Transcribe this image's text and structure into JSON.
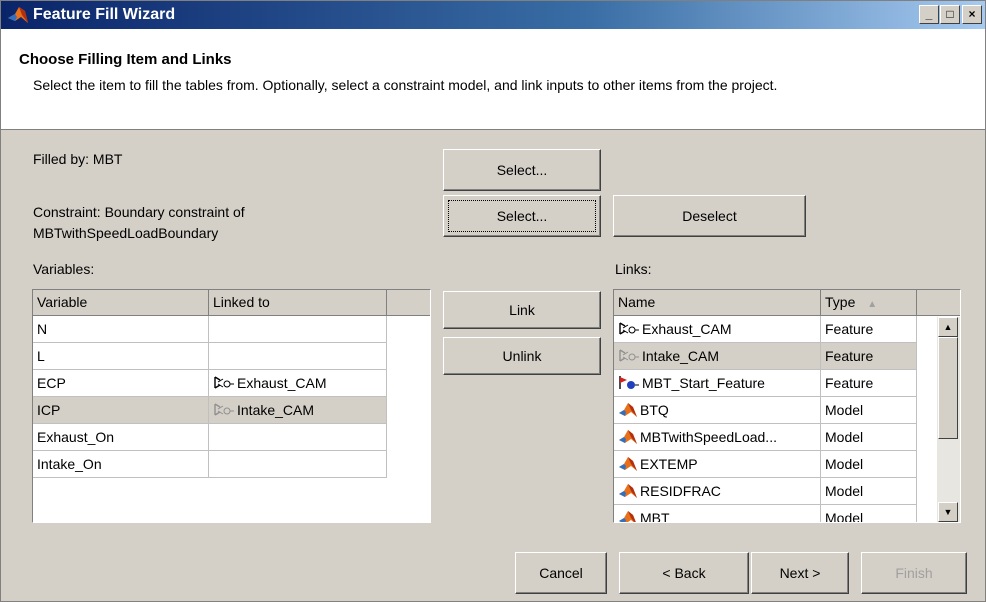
{
  "window": {
    "title": "Feature Fill Wizard",
    "controls": [
      "_",
      "□",
      "×"
    ]
  },
  "header": {
    "title": "Choose Filling Item and Links",
    "description": "Select the item to fill the tables from. Optionally, select a constraint model, and link inputs to other items from the project."
  },
  "filled_by": "Filled by: MBT",
  "constraint": {
    "line1": "Constraint: Boundary constraint of",
    "line2": "MBTwithSpeedLoadBoundary"
  },
  "buttons": {
    "select1": "Select...",
    "select2": "Select...",
    "deselect": "Deselect",
    "link": "Link",
    "unlink": "Unlink",
    "cancel": "Cancel",
    "back": "< Back",
    "next": "Next >",
    "finish": "Finish"
  },
  "variables": {
    "label": "Variables:",
    "columns": [
      "Variable",
      "Linked to"
    ],
    "rows": [
      {
        "variable": "N",
        "linked": "",
        "icon": ""
      },
      {
        "variable": "L",
        "linked": "",
        "icon": ""
      },
      {
        "variable": "ECP",
        "linked": "Exhaust_CAM",
        "icon": "feature-icon"
      },
      {
        "variable": "ICP",
        "linked": "Intake_CAM",
        "icon": "feature-faded-icon"
      },
      {
        "variable": "Exhaust_On",
        "linked": "",
        "icon": ""
      },
      {
        "variable": "Intake_On",
        "linked": "",
        "icon": ""
      }
    ],
    "selected_row": 3
  },
  "links": {
    "label": "Links:",
    "columns": [
      "Name",
      "Type"
    ],
    "sort_indicator": "▲",
    "rows": [
      {
        "name": "Exhaust_CAM",
        "type": "Feature",
        "icon": "feature-icon"
      },
      {
        "name": "Intake_CAM",
        "type": "Feature",
        "icon": "feature-faded-icon"
      },
      {
        "name": "MBT_Start_Feature",
        "type": "Feature",
        "icon": "feature-start-icon"
      },
      {
        "name": "BTQ",
        "type": "Model",
        "icon": "model-icon"
      },
      {
        "name": "MBTwithSpeedLoad...",
        "type": "Model",
        "icon": "model-icon"
      },
      {
        "name": "EXTEMP",
        "type": "Model",
        "icon": "model-icon"
      },
      {
        "name": "RESIDFRAC",
        "type": "Model",
        "icon": "model-icon"
      },
      {
        "name": "MBT",
        "type": "Model",
        "icon": "model-icon"
      }
    ],
    "selected_row": 1
  }
}
